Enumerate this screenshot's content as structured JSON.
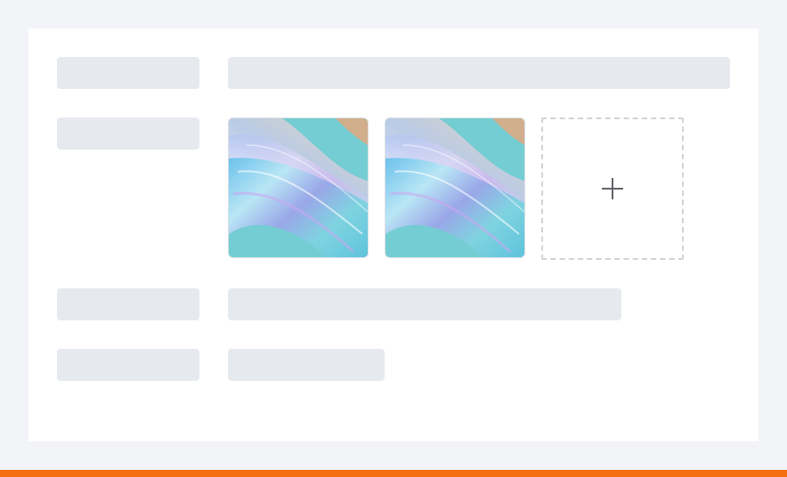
{
  "form": {
    "rows": [
      {
        "kind": "skeleton-text"
      },
      {
        "kind": "image-upload",
        "images": [
          {
            "alt": "",
            "icon": "iridescent-abstract-image"
          },
          {
            "alt": "",
            "icon": "iridescent-abstract-image"
          }
        ],
        "add_icon": "plus-icon"
      },
      {
        "kind": "skeleton-text"
      },
      {
        "kind": "skeleton-text"
      }
    ]
  },
  "colors": {
    "page_background": "#f3f4f8",
    "card_background": "#ffffff",
    "skeleton": "#e6e9ee",
    "upload_border": "#d0d3d9",
    "plus_icon": "#606266",
    "accent_bar": "#f36f10",
    "image_base": "#73cdd2"
  }
}
